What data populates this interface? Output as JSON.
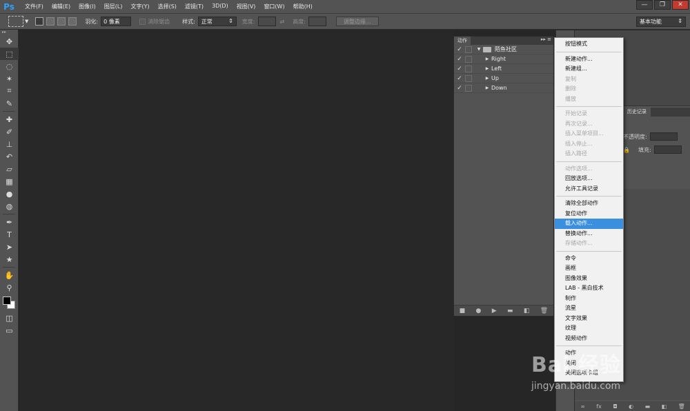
{
  "app": {
    "logo": "Ps"
  },
  "menubar": {
    "items": [
      "文件(F)",
      "编辑(E)",
      "图像(I)",
      "图层(L)",
      "文字(Y)",
      "选择(S)",
      "滤镜(T)",
      "3D(D)",
      "视图(V)",
      "窗口(W)",
      "帮助(H)"
    ]
  },
  "window_controls": {
    "minimize": "—",
    "restore": "❐",
    "close": "✕"
  },
  "options": {
    "feather_label": "羽化:",
    "feather_value": "0 像素",
    "antialias_label": "消除锯齿",
    "style_label": "样式:",
    "style_value": "正常",
    "width_label": "宽度:",
    "height_label": "高度:",
    "refine_edge_label": "调整边缘...",
    "workspace_value": "基本功能"
  },
  "actions_panel": {
    "tab_label": "动作",
    "set_name": "陌鱼社区",
    "actions": [
      "Right",
      "Left",
      "Up",
      "Down"
    ]
  },
  "right_panels": {
    "history_tab": "历史记录",
    "opacity_label": "不透明度:",
    "fill_label": "填充:"
  },
  "flyout_menu": {
    "groups": [
      [
        {
          "label": "按钮模式",
          "enabled": true
        }
      ],
      [
        {
          "label": "新建动作...",
          "enabled": true
        },
        {
          "label": "新建组...",
          "enabled": true
        },
        {
          "label": "复制",
          "enabled": false
        },
        {
          "label": "删除",
          "enabled": false
        },
        {
          "label": "播放",
          "enabled": false
        }
      ],
      [
        {
          "label": "开始记录",
          "enabled": false
        },
        {
          "label": "再次记录...",
          "enabled": false
        },
        {
          "label": "插入菜单项目...",
          "enabled": false
        },
        {
          "label": "插入停止...",
          "enabled": false
        },
        {
          "label": "插入路径",
          "enabled": false
        }
      ],
      [
        {
          "label": "动作选项...",
          "enabled": false
        },
        {
          "label": "回放选项...",
          "enabled": true
        },
        {
          "label": "允许工具记录",
          "enabled": true
        }
      ],
      [
        {
          "label": "清除全部动作",
          "enabled": true
        },
        {
          "label": "复位动作",
          "enabled": true
        },
        {
          "label": "载入动作...",
          "enabled": true,
          "highlighted": true
        },
        {
          "label": "替换动作...",
          "enabled": true
        },
        {
          "label": "存储动作...",
          "enabled": false
        }
      ],
      [
        {
          "label": "命令",
          "enabled": true
        },
        {
          "label": "画框",
          "enabled": true
        },
        {
          "label": "图像效果",
          "enabled": true
        },
        {
          "label": "LAB - 黑白技术",
          "enabled": true
        },
        {
          "label": "制作",
          "enabled": true
        },
        {
          "label": "流星",
          "enabled": true
        },
        {
          "label": "文字效果",
          "enabled": true
        },
        {
          "label": "纹理",
          "enabled": true
        },
        {
          "label": "视频动作",
          "enabled": true
        }
      ],
      [
        {
          "label": "动作",
          "enabled": true
        },
        {
          "label": "关闭",
          "enabled": true
        },
        {
          "label": "关闭选项卡组",
          "enabled": true
        }
      ]
    ]
  },
  "watermark": {
    "brand": "Bai 经验",
    "url": "jingyan.baidu.com"
  }
}
